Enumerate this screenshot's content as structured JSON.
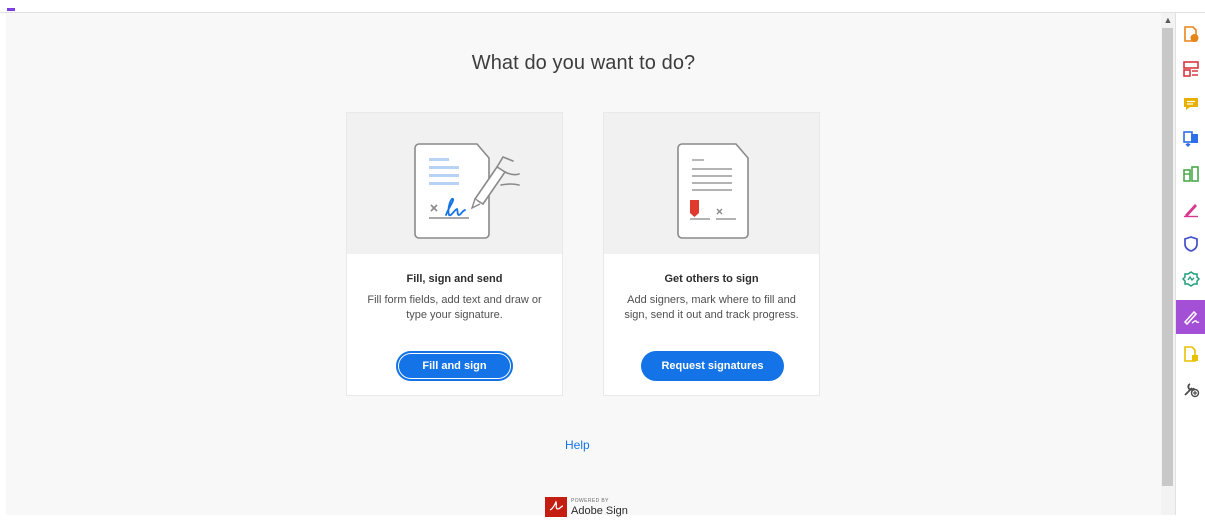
{
  "main": {
    "title": "What do you want to do?",
    "cards": [
      {
        "title": "Fill, sign and send",
        "description": "Fill form fields, add text and draw or type your signature.",
        "button": "Fill and sign"
      },
      {
        "title": "Get others to sign",
        "description": "Add signers, mark where to fill and sign, send it out and track progress.",
        "button": "Request signatures"
      }
    ],
    "help": "Help",
    "footer": {
      "powered_by": "POWERED BY",
      "brand": "Adobe Sign"
    }
  },
  "tools_panel": {
    "items": [
      {
        "icon": "export-pdf-icon",
        "color": "#e68619"
      },
      {
        "icon": "organize-pages-icon",
        "color": "#d7373f"
      },
      {
        "icon": "comment-icon",
        "color": "#e8b000"
      },
      {
        "icon": "combine-files-icon",
        "color": "#2d6de8"
      },
      {
        "icon": "edit-pdf-icon",
        "color": "#4aa84a"
      },
      {
        "icon": "fill-sign-icon",
        "color": "#d83790"
      },
      {
        "icon": "protect-icon",
        "color": "#4150c8"
      },
      {
        "icon": "compare-icon",
        "color": "#1e9e7a"
      },
      {
        "icon": "request-signatures-icon",
        "color": "#ffffff",
        "active": true
      },
      {
        "icon": "prepare-form-icon",
        "color": "#e8c100"
      },
      {
        "icon": "more-tools-icon",
        "color": "#4b4b4b"
      }
    ],
    "active_color": "#a34fd6"
  },
  "colors": {
    "accent": "#1473e6",
    "signature_accent": "#e03a2e"
  }
}
